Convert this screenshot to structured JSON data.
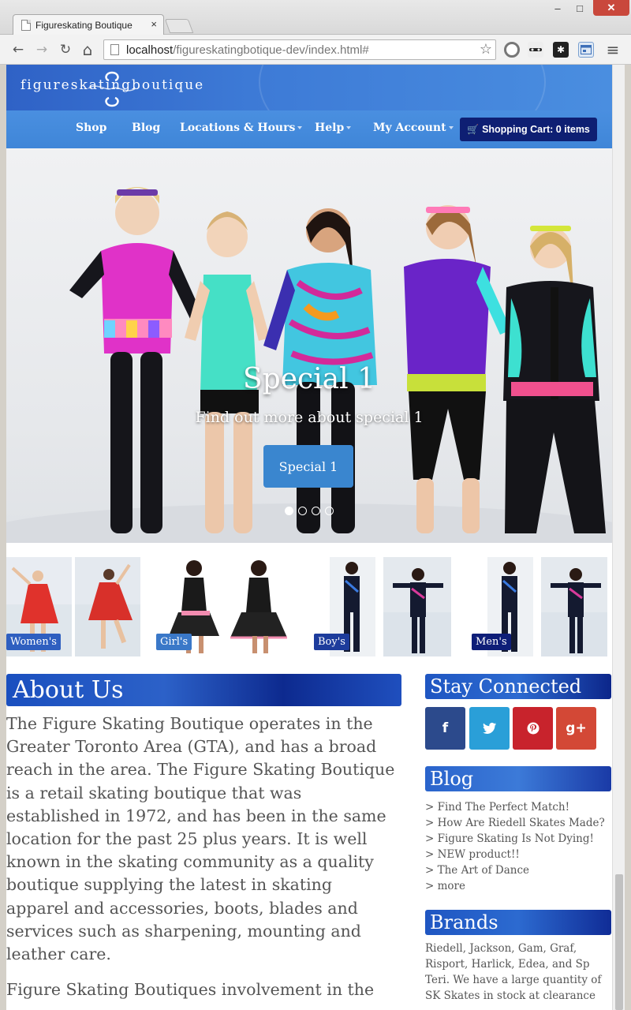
{
  "browser": {
    "tab_title": "Figureskating Boutique",
    "tab_close": "×",
    "win_min": "–",
    "win_max": "□",
    "win_close": "✕",
    "url_host": "localhost",
    "url_path": "/figureskatingbotique-dev/index.html#",
    "back_glyph": "←",
    "forward_glyph": "→",
    "reload_glyph": "↻",
    "home_glyph": "⌂",
    "star_glyph": "☆",
    "menu_glyph": "≡"
  },
  "header": {
    "logo_text": "figureskatingboutique"
  },
  "nav": {
    "items": [
      {
        "label": "Shop",
        "dropdown": false
      },
      {
        "label": "Blog",
        "dropdown": false
      },
      {
        "label": "Locations & Hours",
        "dropdown": true
      },
      {
        "label": "Help",
        "dropdown": true
      },
      {
        "label": "My Account",
        "dropdown": true
      }
    ],
    "cart_icon": "shopping-cart-icon",
    "cart_label": "Shopping Cart: 0 items"
  },
  "hero": {
    "title": "Special 1",
    "subtitle": "Find out more about special 1",
    "button_label": "Special 1",
    "slide_count": 4,
    "active_slide": 1
  },
  "categories": [
    {
      "label": "Women's",
      "color": "#2f5fc0"
    },
    {
      "label": "Girl's",
      "color": "#3a78c8"
    },
    {
      "label": "Boy's",
      "color": "#1d3c9c"
    },
    {
      "label": "Men's",
      "color": "#0e1e78"
    }
  ],
  "about": {
    "heading": "About Us",
    "paragraphs": [
      "The Figure Skating Boutique operates in the Greater Toronto Area (GTA), and has a broad reach in the area. The Figure Skating Boutique is a retail skating boutique that was established in 1972, and has been in the same location for the past 25 plus years. It is well known in the skating community as a quality boutique supplying the latest in skating apparel and accessories, boots, blades and services such as sharpening, mounting and leather care.",
      "Figure Skating Boutiques involvement in the"
    ]
  },
  "sidebar": {
    "stay_connected": "Stay Connected",
    "social": [
      {
        "name": "facebook-icon",
        "glyph": "f",
        "color": "#2c4a8c"
      },
      {
        "name": "twitter-icon",
        "glyph": "t",
        "color": "#2a9fd8"
      },
      {
        "name": "pinterest-icon",
        "glyph": "p",
        "color": "#c8232c"
      },
      {
        "name": "google-plus-icon",
        "glyph": "g+",
        "color": "#d34836"
      }
    ],
    "blog_heading": "Blog",
    "blog_items": [
      "> Find The Perfect Match!",
      "> How Are Riedell Skates Made?",
      "> Figure Skating Is Not Dying!",
      "> NEW product!!",
      "> The Art of Dance",
      "> more"
    ],
    "brands_heading": "Brands",
    "brands_text": "Riedell, Jackson, Gam, Graf, Risport, Harlick, Edea, and Sp Teri. We have a large quantity of SK Skates in stock at clearance"
  }
}
